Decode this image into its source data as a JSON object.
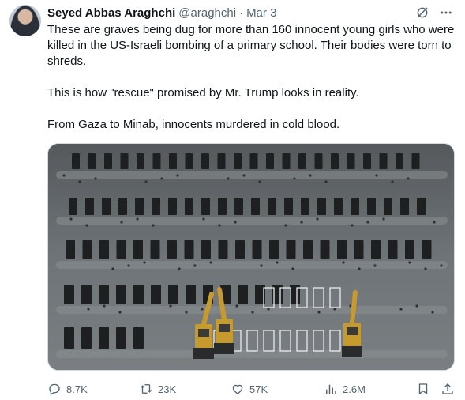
{
  "author": {
    "name": "Seyed Abbas Araghchi",
    "handle": "@araghchi",
    "separator": "·",
    "date": "Mar 3"
  },
  "tweet": {
    "paragraphs": [
      "These are graves being dug for more than 160 innocent young girls who were killed in the US-Israeli bombing of a primary school. Their bodies were torn to shreds.",
      "This is how \"rescue\" promised by Mr. Trump looks in reality.",
      "From Gaza to Minab, innocents murdered in cold blood."
    ]
  },
  "media": {
    "description": "aerial-photo-of-graves-and-excavators",
    "colors": {
      "ground": "#6d7276",
      "grave": "#1d1f21",
      "excavator": "#c79a2e"
    }
  },
  "actions": {
    "replies": "8.7K",
    "reposts": "23K",
    "likes": "57K",
    "views": "2.6M"
  },
  "icons": [
    "grok-icon",
    "more-icon",
    "reply-icon",
    "repost-icon",
    "like-icon",
    "views-icon",
    "bookmark-icon",
    "share-icon"
  ]
}
